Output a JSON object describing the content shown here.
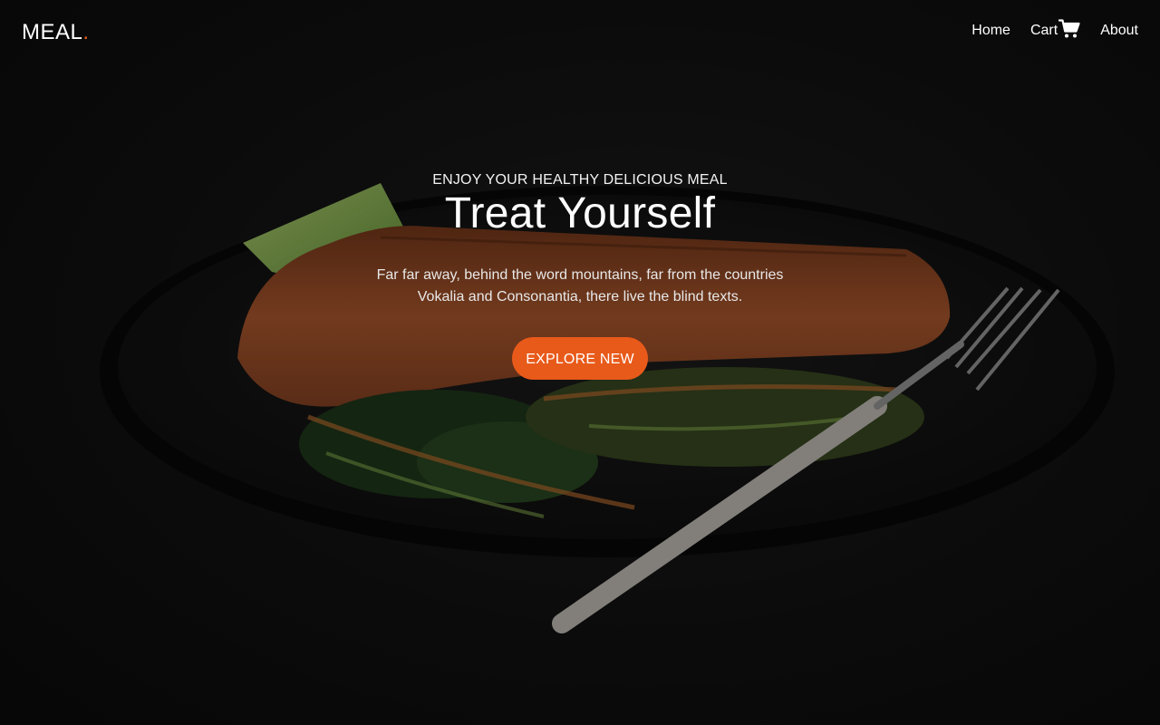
{
  "brand": {
    "name": "MEAL",
    "dot": ".",
    "accent_color": "#e85a1a"
  },
  "nav": {
    "home": "Home",
    "cart": "Cart",
    "cart_icon": "shopping-cart-icon",
    "about": "About"
  },
  "hero": {
    "subheading": "ENJOY YOUR HEALTHY DELICIOUS MEAL",
    "title": "Treat Yourself",
    "text": "Far far away, behind the word mountains, far from the countries Vokalia and Consonantia, there live the blind texts.",
    "button_label": "EXPLORE NEW",
    "background_image": "salmon-plate-photo"
  }
}
